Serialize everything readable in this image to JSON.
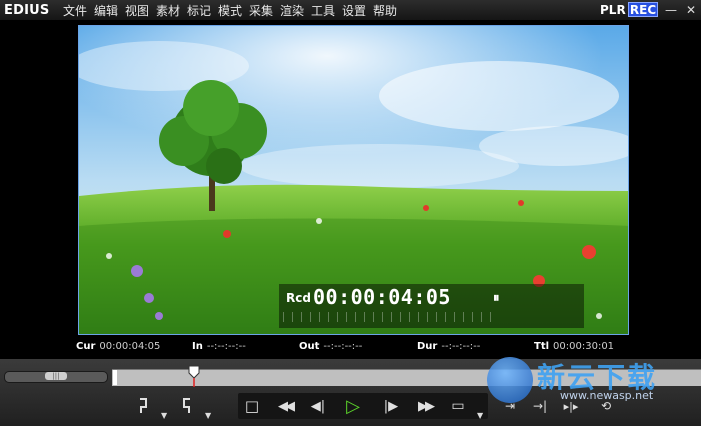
{
  "app": {
    "logo": "EDIUS",
    "plr": "PLR",
    "rec": "REC"
  },
  "menu": [
    "文件",
    "编辑",
    "视图",
    "素材",
    "标记",
    "模式",
    "采集",
    "渲染",
    "工具",
    "设置",
    "帮助"
  ],
  "window_controls": {
    "minimize": "—",
    "close": "✕"
  },
  "overlay": {
    "rcd": "Rcd",
    "timecode": "00:00:04:05",
    "pause": "⏸"
  },
  "timecodes": {
    "cur_label": "Cur",
    "cur_value": "00:00:04:05",
    "in_label": "In",
    "in_value": "--:--:--:--",
    "out_label": "Out",
    "out_value": "--:--:--:--",
    "dur_label": "Dur",
    "dur_value": "--:--:--:--",
    "ttl_label": "Ttl",
    "ttl_value": "00:00:30:01"
  },
  "jog_slider": {
    "grip": "|||"
  },
  "transport": {
    "stop": "□",
    "rewind": "◀◀",
    "step_back": "◀|",
    "play": "▷",
    "step_forward": "|▶",
    "fast_forward": "▶▶",
    "output": "▭"
  },
  "watermark": {
    "text": "新云下载",
    "url": "www.newasp.net"
  }
}
